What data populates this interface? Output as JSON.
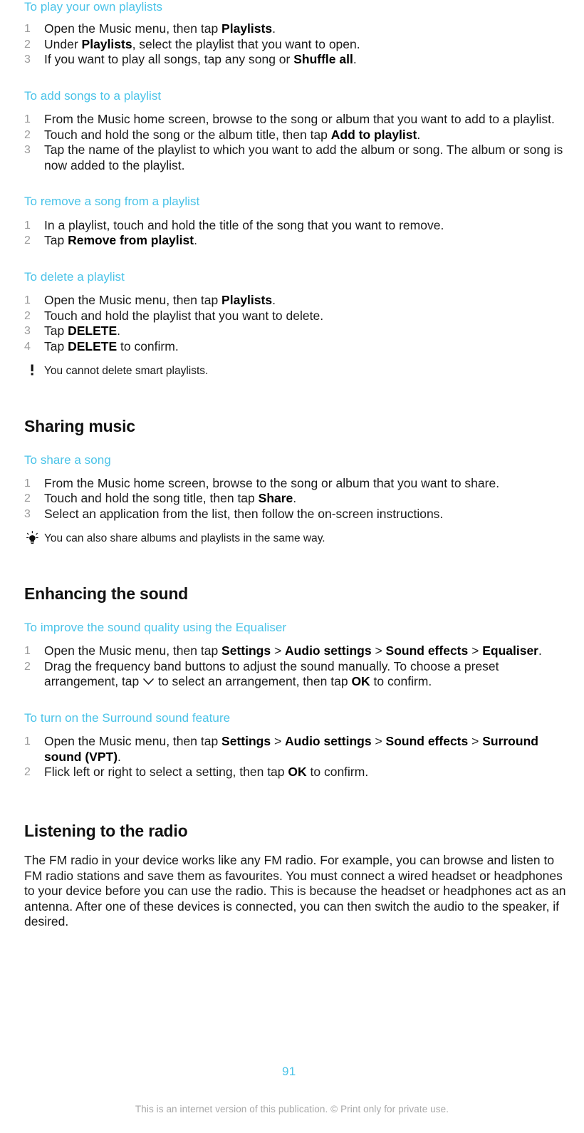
{
  "document": {
    "page_number": "91",
    "disclaimer": "This is an internet version of this publication. © Print only for private use.",
    "accent_color": "#4ac3e8",
    "text_color": "#1a1a1a",
    "marker_color": "#9b9b9b"
  },
  "procedures": {
    "play_own_playlists": {
      "title": "To play your own playlists",
      "steps": [
        {
          "before": "Open the Music menu, then tap ",
          "bold": "Playlists",
          "after": "."
        },
        {
          "before": "Under ",
          "bold": "Playlists",
          "after": ", select the playlist that you want to open."
        },
        {
          "before": "If you want to play all songs, tap any song or ",
          "bold": "Shuffle all",
          "after": "."
        }
      ]
    },
    "add_songs": {
      "title": "To add songs to a playlist",
      "steps": [
        {
          "before": "From the Music home screen, browse to the song or album that you want to add to a playlist.",
          "bold": "",
          "after": ""
        },
        {
          "before": "Touch and hold the song or the album title, then tap ",
          "bold": "Add to playlist",
          "after": "."
        },
        {
          "before": "Tap the name of the playlist to which you want to add the album or song. The album or song is now added to the playlist.",
          "bold": "",
          "after": ""
        }
      ]
    },
    "remove_song": {
      "title": "To remove a song from a playlist",
      "steps": [
        {
          "before": "In a playlist, touch and hold the title of the song that you want to remove.",
          "bold": "",
          "after": ""
        },
        {
          "before": "Tap ",
          "bold": "Remove from playlist",
          "after": "."
        }
      ]
    },
    "delete_playlist": {
      "title": "To delete a playlist",
      "steps": [
        {
          "before": "Open the Music menu, then tap ",
          "bold": "Playlists",
          "after": "."
        },
        {
          "before": "Touch and hold the playlist that you want to delete.",
          "bold": "",
          "after": ""
        },
        {
          "before": "Tap ",
          "bold": "DELETE",
          "after": "."
        },
        {
          "before": "Tap ",
          "bold": "DELETE",
          "after": " to confirm."
        }
      ],
      "note": "You cannot delete smart playlists."
    },
    "share_song": {
      "title": "To share a song",
      "steps": [
        {
          "before": "From the Music home screen, browse to the song or album that you want to share.",
          "bold": "",
          "after": ""
        },
        {
          "before": "Touch and hold the song title, then tap ",
          "bold": "Share",
          "after": "."
        },
        {
          "before": "Select an application from the list, then follow the on-screen instructions.",
          "bold": "",
          "after": ""
        }
      ],
      "tip": "You can also share albums and playlists in the same way."
    },
    "equaliser": {
      "title": "To improve the sound quality using the Equaliser",
      "step1": {
        "p1": "Open the Music menu, then tap ",
        "b1": "Settings",
        "sep1": " > ",
        "b2": "Audio settings",
        "sep2": " > ",
        "b3": "Sound effects",
        "sep3": " > ",
        "b4": "Equaliser",
        "end": "."
      },
      "step2": {
        "p1": "Drag the frequency band buttons to adjust the sound manually. To choose a preset arrangement, tap ",
        "p2": " to select an arrangement, then tap ",
        "b1": "OK",
        "p3": " to confirm."
      }
    },
    "surround": {
      "title": "To turn on the Surround sound feature",
      "step1": {
        "p1": "Open the Music menu, then tap ",
        "b1": "Settings",
        "sep1": " > ",
        "b2": "Audio settings",
        "sep2": " > ",
        "b3": "Sound effects",
        "sep3": " > ",
        "b4": "Surround sound (VPT)",
        "end": "."
      },
      "step2": {
        "p1": "Flick left or right to select a setting, then tap ",
        "b1": "OK",
        "p2": " to confirm."
      }
    }
  },
  "sections": {
    "sharing_music": {
      "title": "Sharing music"
    },
    "enhancing_sound": {
      "title": "Enhancing the sound"
    },
    "listening_radio": {
      "title": "Listening to the radio",
      "body": "The FM radio in your device works like any FM radio. For example, you can browse and listen to FM radio stations and save them as favourites. You must connect a wired headset or headphones to your device before you can use the radio. This is because the headset or headphones act as an antenna. After one of these devices is connected, you can then switch the audio to the speaker, if desired."
    }
  },
  "icons": {
    "note": "exclamation-icon",
    "tip": "lightbulb-icon",
    "chevron": "chevron-down-icon"
  }
}
